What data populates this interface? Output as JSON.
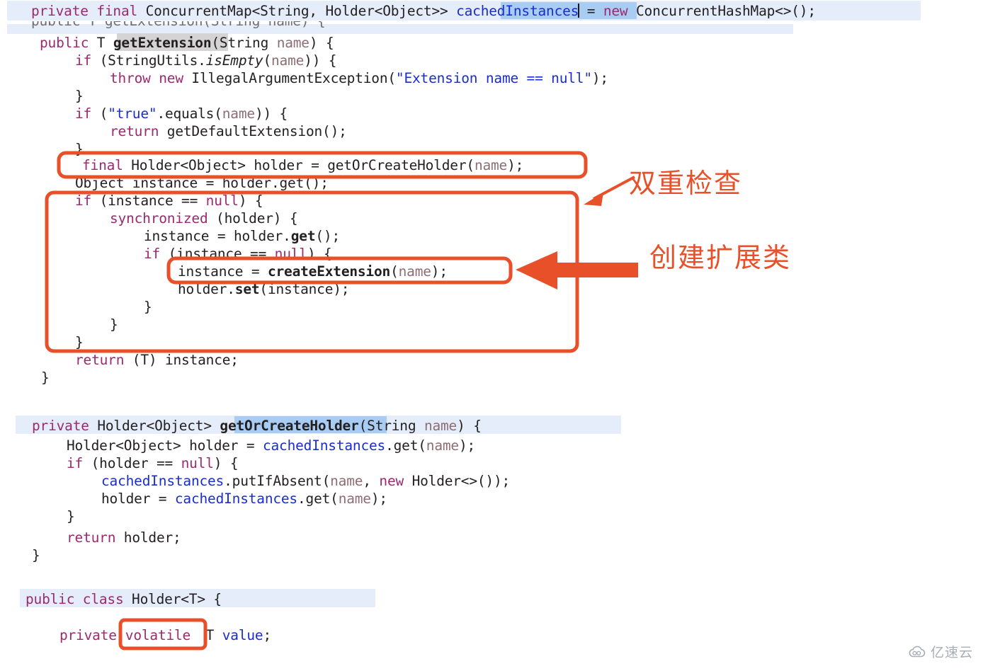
{
  "editor": {
    "language": "java",
    "colors": {
      "keyword": "#9c2a6e",
      "string": "#1a2ecc",
      "field": "#1a2ecc",
      "parameter": "#8d6e74",
      "plain": "#231f20",
      "line_highlight": "#e4edf9",
      "selection": "#a9ccf2",
      "occurrence": "#d4d4d4",
      "annotation": "#e8502a"
    },
    "declaration_line": {
      "full_text": "private final ConcurrentMap<String, Holder<Object>> cachedInstances = new ConcurrentHashMap<>();",
      "t1": "private",
      "t2": " final ",
      "t3": "ConcurrentMap<String, Holder<Object>> ",
      "t4": "cachedInstances",
      "t5": " = ",
      "t6": "new",
      "t7": " ConcurrentHashMap<>();"
    },
    "ghost_line": {
      "text": "public T getExtension(String name) {"
    },
    "method_get_extension": {
      "l1_a": "public",
      "l1_b": " T ",
      "l1_c": "getExtension",
      "l1_d": "(String ",
      "l1_e": "name",
      "l1_f": ") {",
      "l2_a": "if",
      "l2_b": " (StringUtils.",
      "l2_c": "isEmpty",
      "l2_d": "(",
      "l2_e": "name",
      "l2_f": ")) {",
      "l3_a": "throw new",
      "l3_b": " IllegalArgumentException(",
      "l3_c": "\"Extension name == null\"",
      "l3_d": ");",
      "l4": "}",
      "l5_a": "if",
      "l5_b": " (",
      "l5_c": "\"true\"",
      "l5_d": ".equals(",
      "l5_e": "name",
      "l5_f": ")) {",
      "l6_a": "return",
      "l6_b": " getDefaultExtension();",
      "l7": "}",
      "l8_a": "final",
      "l8_b": " Holder<Object> holder = getOrCreateHolder(",
      "l8_c": "name",
      "l8_d": ");",
      "l9": "Object instance = holder.get();",
      "l10_a": "if",
      "l10_b": " (instance == ",
      "l10_c": "null",
      "l10_d": ") {",
      "l11_a": "synchronized",
      "l11_b": " (holder) {",
      "l12_a": "instance = holder.",
      "l12_b": "get",
      "l12_c": "();",
      "l13_a": "if",
      "l13_b": " (instance == ",
      "l13_c": "null",
      "l13_d": ") {",
      "l14_a": "instance = ",
      "l14_b": "createExtension",
      "l14_c": "(",
      "l14_d": "name",
      "l14_e": ");",
      "l15_a": "holder.",
      "l15_b": "set",
      "l15_c": "(instance);",
      "l16": "}",
      "l17": "}",
      "l18": "}",
      "l19_a": "return",
      "l19_b": " (T) instance;",
      "l20": "}"
    },
    "method_get_or_create_holder": {
      "l1_a": "private",
      "l1_b": " Holder<Object> ",
      "l1_c": "getOrCreateHolder",
      "l1_d": "(String ",
      "l1_e": "name",
      "l1_f": ") {",
      "l2_a": "Holder<Object> holder = ",
      "l2_b": "cachedInstances",
      "l2_c": ".get(",
      "l2_d": "name",
      "l2_e": ");",
      "l3_a": "if",
      "l3_b": " (holder == ",
      "l3_c": "null",
      "l3_d": ") {",
      "l4_a": "cachedInstances",
      "l4_b": ".putIfAbsent(",
      "l4_c": "name",
      "l4_d": ", ",
      "l4_e": "new",
      "l4_f": " Holder<>());",
      "l5_a": "holder = ",
      "l5_b": "cachedInstances",
      "l5_c": ".get(",
      "l5_d": "name",
      "l5_e": ");",
      "l6": "}",
      "l7_a": "return",
      "l7_b": " holder;",
      "l8": "}"
    },
    "class_holder": {
      "l1_a": "public class",
      "l1_b": " Holder<T> {",
      "l2_a": "private",
      "l2_b": "volatile",
      "l2_c": " T ",
      "l2_d": "value",
      "l2_e": ";"
    }
  },
  "annotations": {
    "double_check": "双重检查",
    "create_extension_class": "创建扩展类"
  },
  "watermark": {
    "text": "亿速云",
    "icon": "cloud-icon"
  }
}
